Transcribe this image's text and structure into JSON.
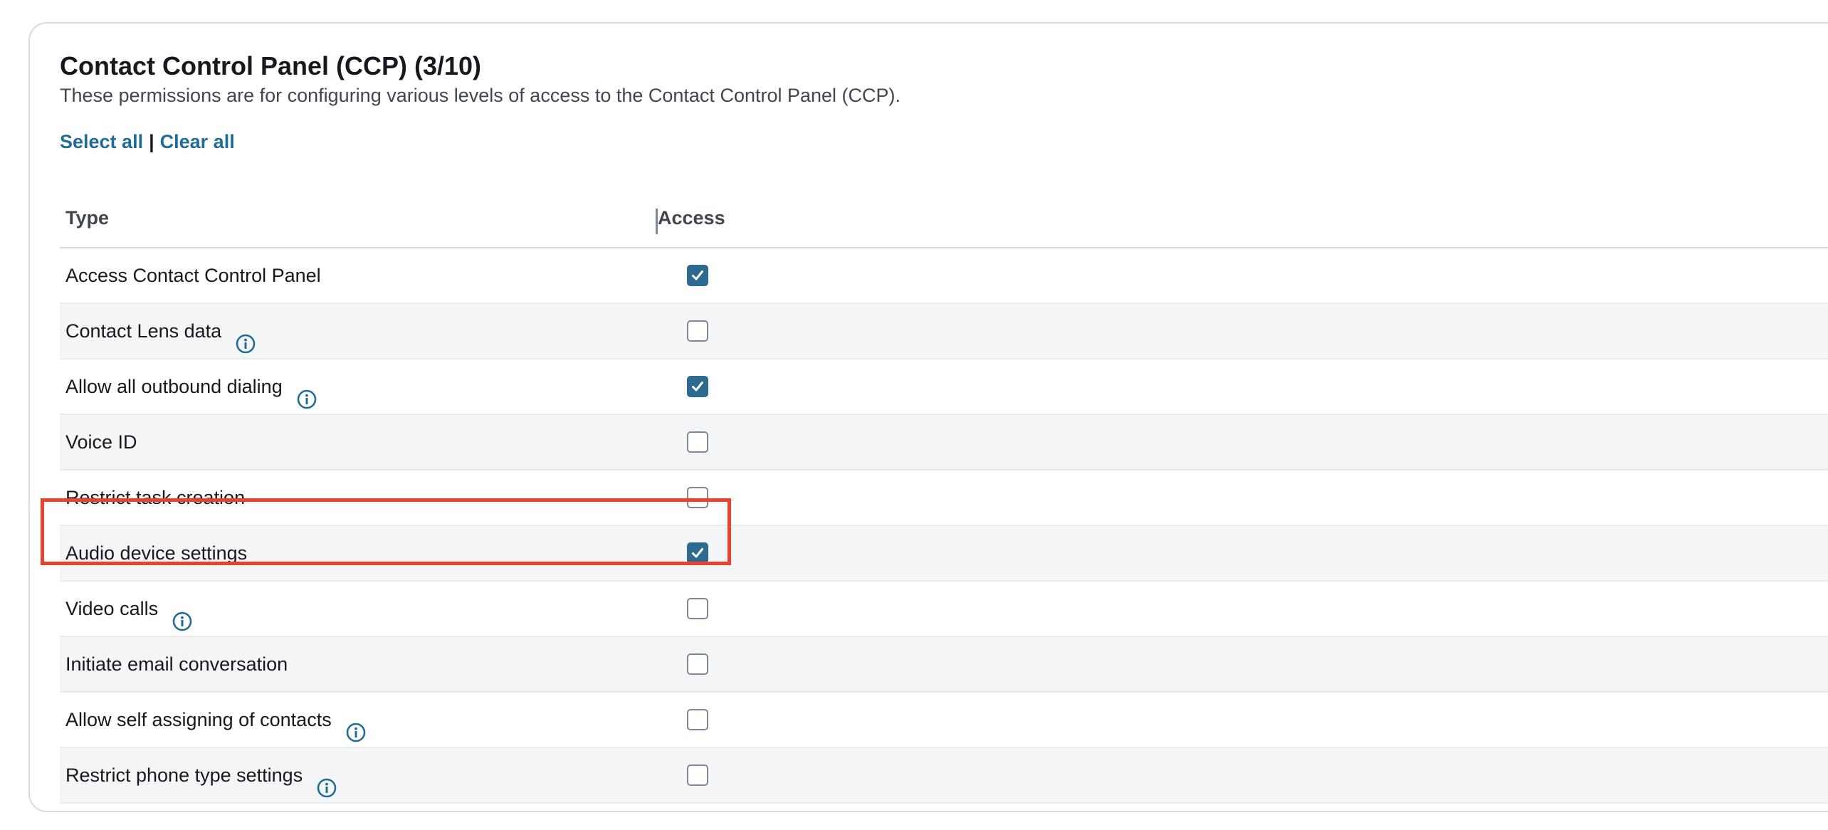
{
  "section": {
    "title": "Contact Control Panel (CCP) (3/10)",
    "description": "These permissions are for configuring various levels of access to the Contact Control Panel (CCP).",
    "select_all": "Select all",
    "separator": "|",
    "clear_all": "Clear all"
  },
  "table": {
    "headers": {
      "type": "Type",
      "access": "Access"
    },
    "rows": [
      {
        "label": "Access Contact Control Panel",
        "info": false,
        "checked": true
      },
      {
        "label": "Contact Lens data",
        "info": true,
        "checked": false
      },
      {
        "label": "Allow all outbound dialing",
        "info": true,
        "checked": true
      },
      {
        "label": "Voice ID",
        "info": false,
        "checked": false
      },
      {
        "label": "Restrict task creation",
        "info": false,
        "checked": false
      },
      {
        "label": "Audio device settings",
        "info": false,
        "checked": true
      },
      {
        "label": "Video calls",
        "info": true,
        "checked": false
      },
      {
        "label": "Initiate email conversation",
        "info": false,
        "checked": false
      },
      {
        "label": "Allow self assigning of contacts",
        "info": true,
        "checked": false
      },
      {
        "label": "Restrict phone type settings",
        "info": true,
        "checked": false
      }
    ]
  },
  "colors": {
    "link": "#1f6d96",
    "checkbox_checked": "#2c6a8f",
    "info_icon": "#1f6d96",
    "highlight": "#e8432e",
    "alt_row": "#f4f5f7"
  },
  "icons": {
    "info": "info-circle-icon",
    "check": "checkmark-icon"
  },
  "highlighted_row": "Audio device settings"
}
